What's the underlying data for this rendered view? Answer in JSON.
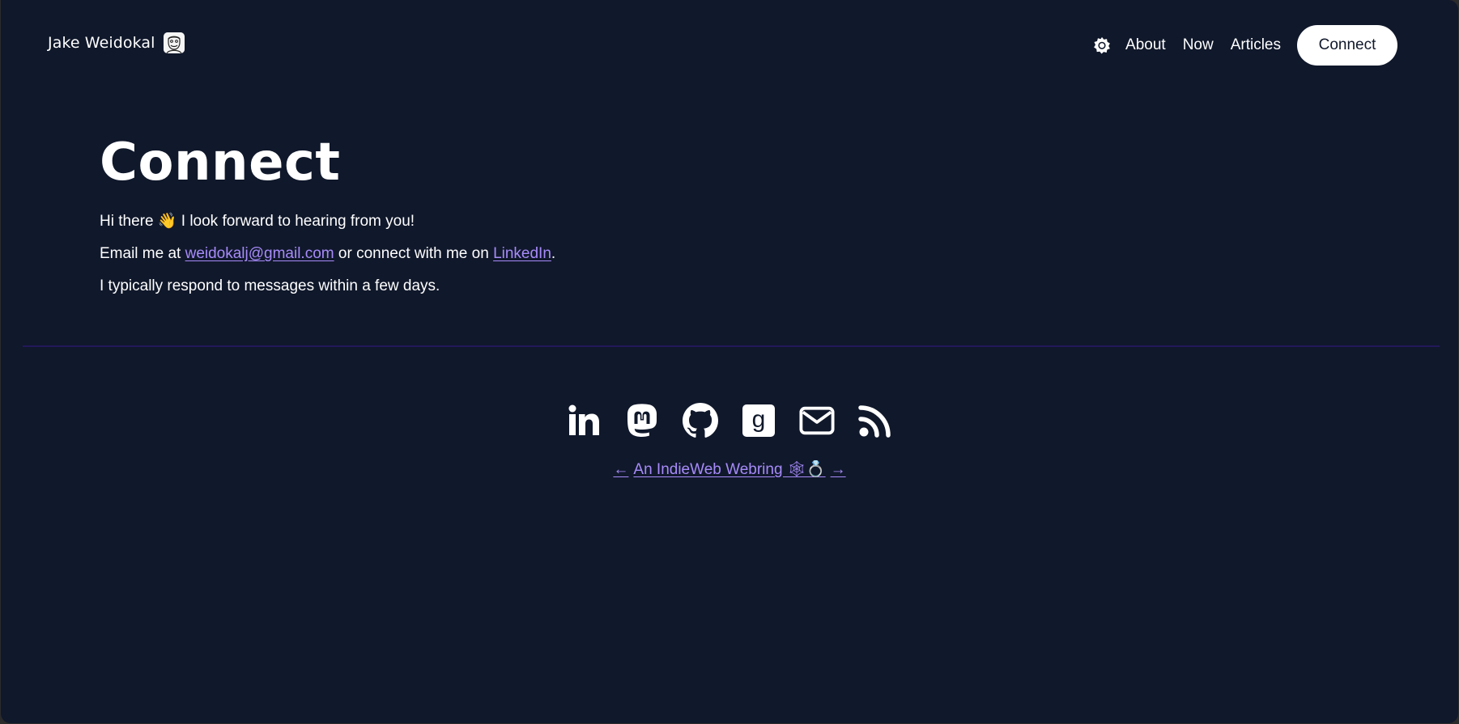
{
  "header": {
    "brand_name": "Jake Weidokal",
    "avatar_icon": "avatar-sketch",
    "theme_toggle_icon": "sun-gear-icon",
    "nav": [
      {
        "label": "About"
      },
      {
        "label": "Now"
      },
      {
        "label": "Articles"
      }
    ],
    "cta_label": "Connect"
  },
  "main": {
    "title": "Connect",
    "greeting_before": "Hi there ",
    "greeting_emoji": "👋",
    "greeting_after": " I look forward to hearing from you!",
    "email_prefix": "Email me at ",
    "email_link": "weidokalj@gmail.com",
    "email_middle": " or connect with me on ",
    "linkedin_link": "LinkedIn",
    "email_suffix": ".",
    "response_note": "I typically respond to messages within a few days."
  },
  "footer": {
    "socials": [
      {
        "name": "LinkedIn",
        "icon": "linkedin-icon"
      },
      {
        "name": "Mastodon",
        "icon": "mastodon-icon"
      },
      {
        "name": "GitHub",
        "icon": "github-icon"
      },
      {
        "name": "Goodreads",
        "icon": "goodreads-icon"
      },
      {
        "name": "Email",
        "icon": "mail-icon"
      },
      {
        "name": "RSS",
        "icon": "rss-icon"
      }
    ],
    "webring_prev": "←",
    "webring_label": "An IndieWeb Webring 🕸💍",
    "webring_next": "→"
  },
  "colors": {
    "background": "#10182b",
    "text": "#ffffff",
    "link": "#a78bfa",
    "divider": "#23185a",
    "cta_bg": "#ffffff"
  }
}
